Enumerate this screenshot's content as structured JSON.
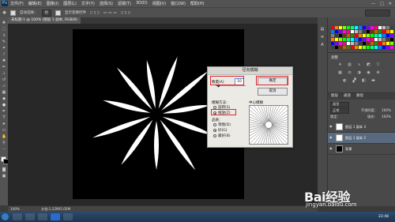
{
  "app": {
    "logo": "Ps"
  },
  "menubar": {
    "items": [
      "文件(F)",
      "编辑(E)",
      "图像(I)",
      "图层(L)",
      "文字(Y)",
      "选择(S)",
      "滤镜(T)",
      "3D(D)",
      "视图(V)",
      "窗口(W)",
      "帮助(H)"
    ],
    "window_controls": [
      "—",
      "□",
      "✕"
    ]
  },
  "options_bar": {
    "auto_select_label": "自动选择：",
    "auto_select_value": "组",
    "show_transform_label": "显示变换控件"
  },
  "document": {
    "tab_label": "未标题-1 @ 100% (图层 1 副本, RGB/8)"
  },
  "dialog": {
    "title": "径向模糊",
    "amount_label": "数量(A)",
    "amount_value": "10",
    "ok_label": "确定",
    "cancel_label": "取消",
    "blur_method_label": "模糊方法：",
    "method_spin": "旋转(S)",
    "method_zoom": "缩放(Z)",
    "method_selected": "zoom",
    "quality_label": "品质：",
    "quality_draft": "草图(D)",
    "quality_good": "好(G)",
    "quality_best": "最好(B)",
    "quality_selected": "good",
    "blur_center_label": "中心模糊"
  },
  "adjustments": {
    "title": "调整"
  },
  "layers": {
    "tabs": [
      "图层",
      "通道",
      "路径"
    ],
    "kind_label": "类型",
    "blend_mode": "正常",
    "opacity_label": "不透明度:",
    "opacity_value": "100%",
    "lock_label": "锁定:",
    "fill_label": "填充:",
    "fill_value": "100%",
    "rows": [
      {
        "name": "图层 1 副本 3",
        "thumb": "#ffffff",
        "active": false
      },
      {
        "name": "图层 1 副本 2",
        "thumb": "#ffffff",
        "active": true
      },
      {
        "name": "背景",
        "thumb": "#000000",
        "active": false
      }
    ]
  },
  "status": {
    "zoom": "100%",
    "doc_info": "文档:1.22M/5.05M"
  },
  "taskbar": {
    "clock": "22:48"
  },
  "watermark": {
    "logo": "Bai经验",
    "url": "jingyan.baidu.com"
  },
  "swatch_colors": [
    "#ff0000",
    "#ff8000",
    "#ffff00",
    "#80ff00",
    "#00ff00",
    "#00ff80",
    "#00ffff",
    "#0080ff",
    "#0000ff",
    "#8000ff",
    "#ff00ff",
    "#ff0080",
    "#ffffff",
    "#c0c0c0",
    "#808080",
    "#404040",
    "#000000",
    "#803000",
    "#c06000",
    "#408000"
  ]
}
